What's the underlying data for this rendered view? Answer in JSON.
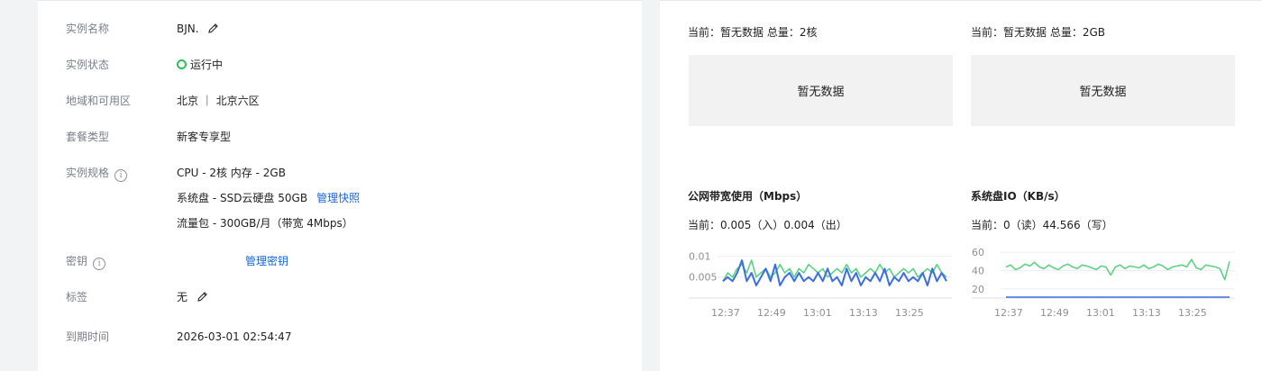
{
  "details": {
    "name": {
      "label": "实例名称",
      "value": "BJN."
    },
    "status": {
      "label": "实例状态",
      "value": "运行中"
    },
    "region": {
      "label": "地域和可用区",
      "value": "北京 ｜ 北京六区"
    },
    "package": {
      "label": "套餐类型",
      "value": "新客专享型"
    },
    "spec": {
      "label": "实例规格",
      "line1": "CPU - 2核 内存 - 2GB",
      "line2": "系统盘 - SSD云硬盘 50GB",
      "line2_link": "管理快照",
      "line3": "流量包 - 300GB/月（带宽 4Mbps）"
    },
    "key": {
      "label": "密钥",
      "link": "管理密钥"
    },
    "tags": {
      "label": "标签",
      "value": "无"
    },
    "expire": {
      "label": "到期时间",
      "value": "2026-03-01 02:54:47"
    }
  },
  "metrics": {
    "cpu": {
      "current": "当前：暂无数据 总量：2核",
      "nodata": "暂无数据"
    },
    "mem": {
      "current": "当前：暂无数据 总量：2GB",
      "nodata": "暂无数据"
    },
    "bandwidth": {
      "title": "公网带宽使用（Mbps）",
      "current": "当前：0.005（入）0.004（出）"
    },
    "diskio": {
      "title": "系统盘IO（KB/s）",
      "current": "当前：0（读）44.566（写）"
    }
  },
  "chart_data": [
    {
      "type": "line",
      "title": "公网带宽使用（Mbps）",
      "x_ticks": [
        "12:37",
        "12:49",
        "13:01",
        "13:13",
        "13:25"
      ],
      "y_ticks": [
        "0.01",
        "0.005"
      ],
      "ylim": [
        0,
        0.012
      ],
      "series": [
        {
          "color": "#5dd184",
          "values": [
            0.004,
            0.006,
            0.005,
            0.007,
            0.008,
            0.006,
            0.009,
            0.005,
            0.006,
            0.007,
            0.005,
            0.006,
            0.008,
            0.006,
            0.007,
            0.005,
            0.007,
            0.006,
            0.008,
            0.007,
            0.006,
            0.007,
            0.005,
            0.006,
            0.007,
            0.006,
            0.008,
            0.006,
            0.007,
            0.005,
            0.006,
            0.007,
            0.006,
            0.008,
            0.006,
            0.007,
            0.005,
            0.006,
            0.007,
            0.006,
            0.007,
            0.005,
            0.006,
            0.007,
            0.006,
            0.008,
            0.006,
            0.005
          ]
        },
        {
          "color": "#3d6ee0",
          "values": [
            0.004,
            0.005,
            0.004,
            0.006,
            0.009,
            0.004,
            0.006,
            0.003,
            0.005,
            0.007,
            0.004,
            0.008,
            0.003,
            0.005,
            0.006,
            0.004,
            0.006,
            0.004,
            0.005,
            0.004,
            0.006,
            0.004,
            0.007,
            0.004,
            0.005,
            0.003,
            0.007,
            0.004,
            0.006,
            0.003,
            0.005,
            0.004,
            0.006,
            0.004,
            0.007,
            0.003,
            0.005,
            0.004,
            0.006,
            0.004,
            0.005,
            0.004,
            0.006,
            0.003,
            0.007,
            0.004,
            0.006,
            0.004
          ]
        }
      ]
    },
    {
      "type": "line",
      "title": "系统盘IO（KB/s）",
      "x_ticks": [
        "12:37",
        "12:49",
        "13:01",
        "13:13",
        "13:25"
      ],
      "y_ticks": [
        "60",
        "40",
        "20"
      ],
      "ylim": [
        10,
        65
      ],
      "series": [
        {
          "color": "#5dd184",
          "values": [
            44,
            46,
            41,
            43,
            47,
            45,
            49,
            44,
            42,
            46,
            43,
            41,
            45,
            47,
            44,
            42,
            46,
            45,
            43,
            41,
            45,
            44,
            35,
            44,
            46,
            42,
            45,
            44,
            43,
            46,
            42,
            44,
            47,
            45,
            41,
            44,
            45,
            46,
            44,
            52,
            43,
            41,
            46,
            45,
            44,
            42,
            30,
            50
          ]
        },
        {
          "color": "#3d6ee0",
          "values": [
            0,
            0,
            0,
            0,
            0,
            0,
            0,
            0,
            0,
            0,
            0,
            0,
            0,
            0,
            0,
            0,
            0,
            0,
            0,
            0,
            0,
            0,
            0,
            0,
            0,
            0,
            0,
            0,
            0,
            0,
            0,
            0,
            0,
            0,
            0,
            0,
            0,
            0,
            0,
            0,
            0,
            0,
            0,
            0,
            0,
            0,
            0,
            0
          ]
        }
      ]
    }
  ]
}
